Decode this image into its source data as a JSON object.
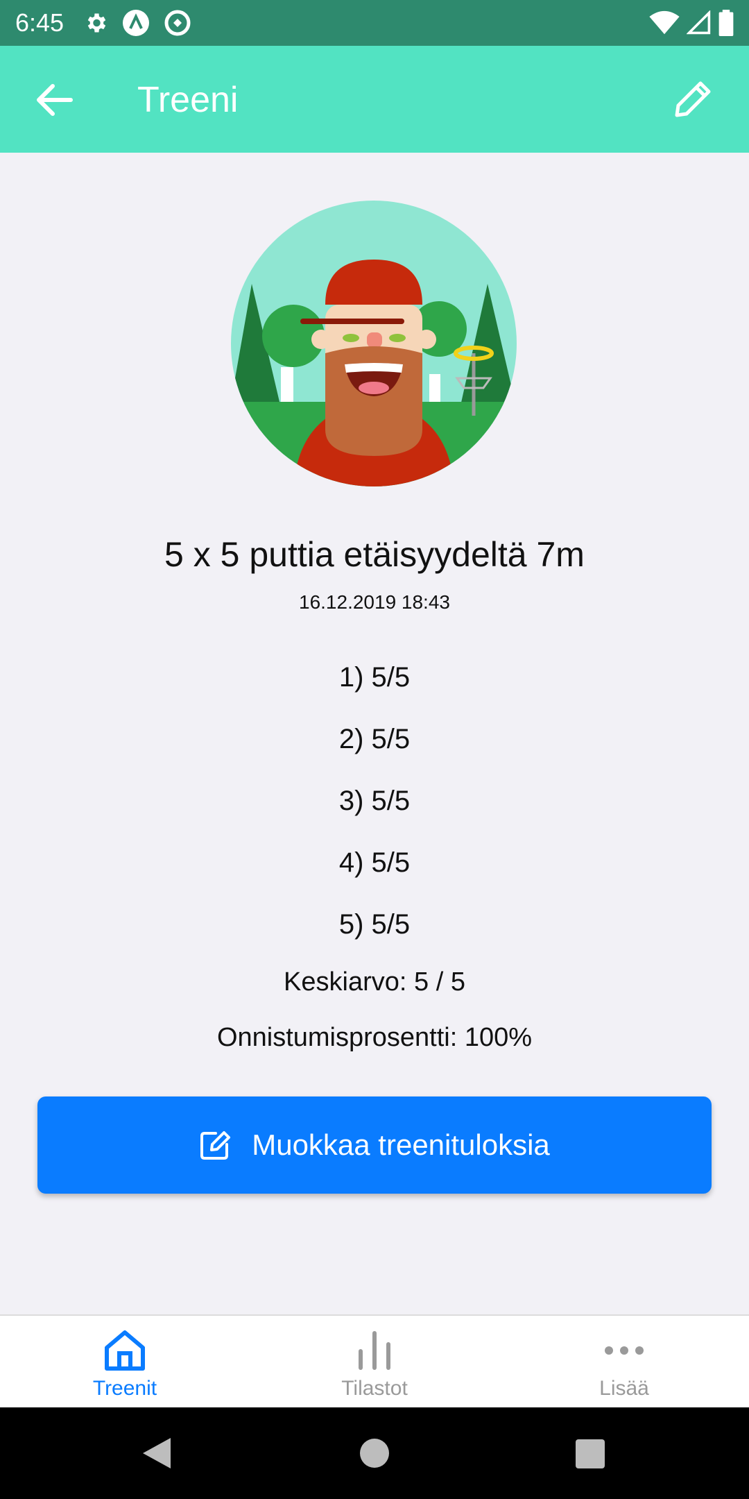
{
  "status_bar": {
    "time": "6:45"
  },
  "app_bar": {
    "title": "Treeni"
  },
  "workout": {
    "title": "5 x 5 puttia etäisyydeltä 7m",
    "datetime": "16.12.2019 18:43",
    "rounds": [
      "1) 5/5",
      "2) 5/5",
      "3) 5/5",
      "4) 5/5",
      "5) 5/5"
    ],
    "average": "Keskiarvo: 5 / 5",
    "success_rate": "Onnistumisprosentti: 100%"
  },
  "edit_button": {
    "label": "Muokkaa treenituloksia"
  },
  "bottom_nav": {
    "items": [
      {
        "label": "Treenit",
        "icon": "home-icon",
        "active": true
      },
      {
        "label": "Tilastot",
        "icon": "bar-chart-icon",
        "active": false
      },
      {
        "label": "Lisää",
        "icon": "more-icon",
        "active": false
      }
    ]
  },
  "colors": {
    "status_bar": "#2e8a6e",
    "app_bar": "#52e3c2",
    "primary": "#0a7cff",
    "inactive": "#9a9a9a",
    "background": "#f2f1f6"
  }
}
